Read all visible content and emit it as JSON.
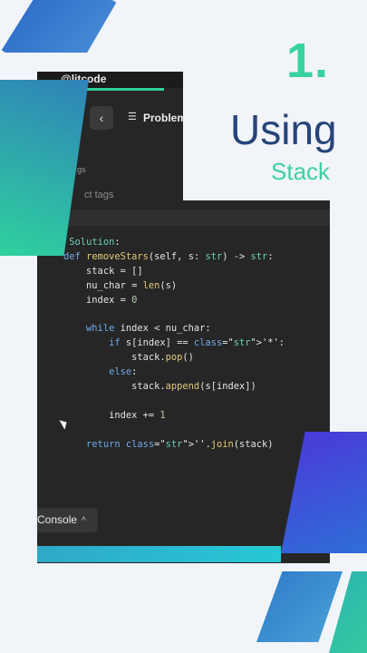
{
  "heading": {
    "number": "1.",
    "title": "Using",
    "subtitle": "Stack"
  },
  "app": {
    "title": "@litcode",
    "back_icon": "chevron-left-icon",
    "menu_icon": "hamburger-icon",
    "problem_label": "Problem",
    "tags_label": "gs",
    "select_tags_placeholder": "ct tags"
  },
  "code": [
    "lass Solution:",
    "    def removeStars(self, s: str) -> str:",
    "        stack = []",
    "        nu_char = len(s)",
    "        index = 0",
    "",
    "        while index < nu_char:",
    "            if s[index] == '*':",
    "                stack.pop()",
    "            else:",
    "                stack.append(s[index])",
    "",
    "            index += 1",
    "",
    "        return ''.join(stack)"
  ],
  "console": {
    "label": "Console",
    "chevron": "^"
  },
  "colors": {
    "accent_green": "#36d39f",
    "heading_blue": "#27447a",
    "editor_bg": "#262626"
  }
}
